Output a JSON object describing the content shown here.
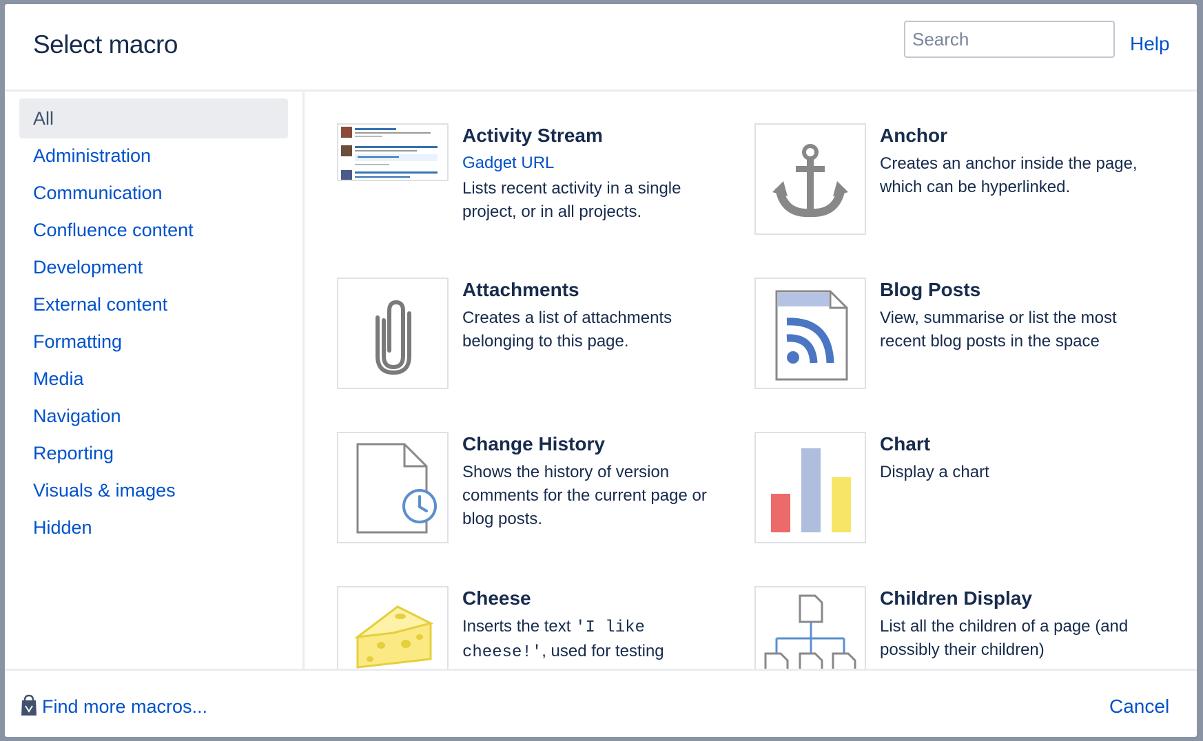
{
  "dialog": {
    "title": "Select macro",
    "search_placeholder": "Search",
    "help_label": "Help"
  },
  "sidebar": {
    "categories": [
      {
        "label": "All",
        "active": true
      },
      {
        "label": "Administration"
      },
      {
        "label": "Communication"
      },
      {
        "label": "Confluence content"
      },
      {
        "label": "Development"
      },
      {
        "label": "External content"
      },
      {
        "label": "Formatting"
      },
      {
        "label": "Media"
      },
      {
        "label": "Navigation"
      },
      {
        "label": "Reporting"
      },
      {
        "label": "Visuals & images"
      },
      {
        "label": "Hidden"
      }
    ]
  },
  "macros": [
    {
      "name": "Activity Stream",
      "link": "Gadget URL",
      "description": "Lists recent activity in a single project, or in all projects.",
      "icon": "activity-stream-thumbnail"
    },
    {
      "name": "Anchor",
      "description": "Creates an anchor inside the page, which can be hyperlinked.",
      "icon": "anchor-icon"
    },
    {
      "name": "Attachments",
      "description": "Creates a list of attachments belonging to this page.",
      "icon": "paperclip-icon"
    },
    {
      "name": "Blog Posts",
      "description": "View, summarise or list the most recent blog posts in the space",
      "icon": "rss-document-icon"
    },
    {
      "name": "Change History",
      "description": "Shows the history of version comments for the current page or blog posts.",
      "icon": "document-clock-icon"
    },
    {
      "name": "Chart",
      "description": "Display a chart",
      "icon": "bar-chart-icon"
    },
    {
      "name": "Cheese",
      "description_prefix": "Inserts the text ",
      "description_code": "'I like cheese!'",
      "description_suffix": ", used for testing",
      "icon": "cheese-icon"
    },
    {
      "name": "Children Display",
      "description": "List all the children of a page (and possibly their children)",
      "icon": "page-tree-icon"
    }
  ],
  "footer": {
    "find_more_label": "Find more macros...",
    "cancel_label": "Cancel"
  },
  "colors": {
    "link": "#0052cc",
    "text": "#172b4d",
    "active_bg": "#ebecf0",
    "backdrop": "#8993a4"
  }
}
